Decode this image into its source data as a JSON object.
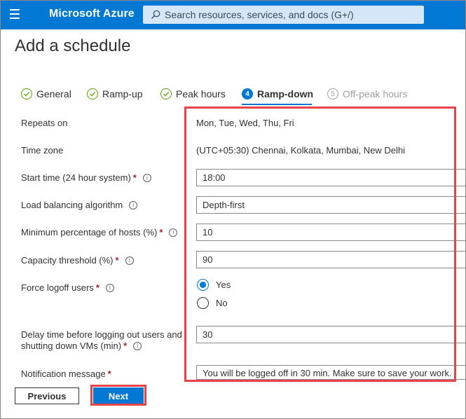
{
  "topbar": {
    "brand": "Microsoft Azure",
    "search_placeholder": "Search resources, services, and docs (G+/)",
    "color": "#0078d4"
  },
  "page_title": "Add a schedule",
  "steps": [
    {
      "label": "General",
      "state": "done",
      "marker": ""
    },
    {
      "label": "Ramp-up",
      "state": "done",
      "marker": ""
    },
    {
      "label": "Peak hours",
      "state": "done",
      "marker": ""
    },
    {
      "label": "Ramp-down",
      "state": "current",
      "marker": "4"
    },
    {
      "label": "Off-peak hours",
      "state": "todo",
      "marker": "5"
    }
  ],
  "form": {
    "repeats_on": {
      "label": "Repeats on",
      "value": "Mon, Tue, Wed, Thu, Fri"
    },
    "time_zone": {
      "label": "Time zone",
      "value": "(UTC+05:30) Chennai, Kolkata, Mumbai, New Delhi"
    },
    "start_time": {
      "label": "Start time (24 hour system)",
      "value": "18:00"
    },
    "load_balancing": {
      "label": "Load balancing algorithm",
      "value": "Depth-first"
    },
    "min_hosts": {
      "label": "Minimum percentage of hosts (%)",
      "value": "10"
    },
    "capacity": {
      "label": "Capacity threshold (%)",
      "value": "90"
    },
    "force_logoff": {
      "label": "Force logoff users",
      "options": [
        "Yes",
        "No"
      ],
      "selected": "Yes"
    },
    "delay_time": {
      "label_line1": "Delay time before logging out users and",
      "label_line2": "shutting down VMs (min)",
      "value": "30"
    },
    "notification": {
      "label": "Notification message",
      "value": "You will be logged off in 30 min. Make sure to save your work."
    },
    "required_marker": "*",
    "info_glyph": "i"
  },
  "buttons": {
    "previous": "Previous",
    "next": "Next"
  },
  "colors": {
    "accent": "#0078d4",
    "highlight": "#e8434a",
    "required": "#a4262c",
    "done": "#57a300"
  }
}
